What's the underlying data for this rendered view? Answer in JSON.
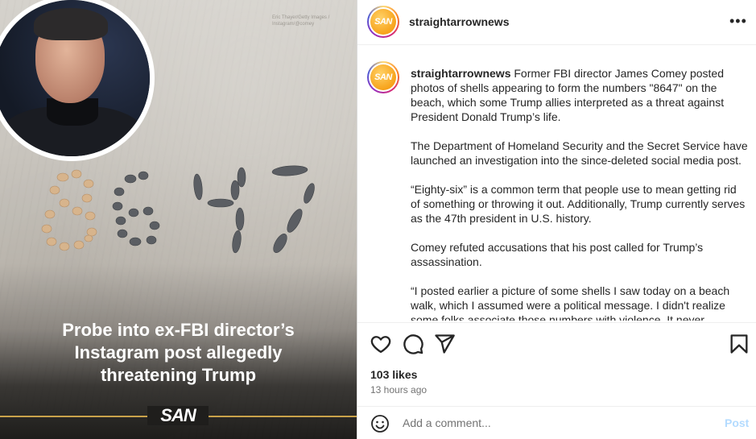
{
  "media": {
    "credit": "Eric Thayer/Getty Images / Instagram/@comey",
    "shell_numbers": "8647",
    "headline_lines": [
      "Probe into ex-FBI director’s",
      "Instagram post allegedly",
      "threatening Trump"
    ],
    "logo": "SAN"
  },
  "post": {
    "avatar_text": "SAN",
    "username": "straightarrownews",
    "more_icon": "more-horizontal-icon",
    "caption_paragraphs": [
      "Former FBI director James Comey posted photos of shells appearing to form the numbers \"8647\" on the beach, which some Trump allies interpreted as a threat against President Donald Trump’s life.",
      "The Department of Homeland Security and the Secret Service have launched an investigation into the since-deleted social media post.",
      "“Eighty-six” is a common term that people use to mean getting rid of something or throwing it out. Additionally, Trump currently serves as the 47th president in U.S. history.",
      "Comey refuted accusations that his post called for Trump’s assassination.",
      "“I posted earlier a picture of some shells I saw today on a beach walk, which I assumed were a political message. I didn't realize some folks associate those numbers with violence. It never occurred to me but I oppose violence of any kind so I took the post down.”"
    ],
    "likes": "103 likes",
    "time": "13 hours ago"
  },
  "comment_box": {
    "placeholder": "Add a comment...",
    "post_label": "Post"
  },
  "colors": {
    "accent_gold": "#c9a24a",
    "post_button": "#b3dbff",
    "text": "#262626",
    "secondary_text": "#737373"
  }
}
